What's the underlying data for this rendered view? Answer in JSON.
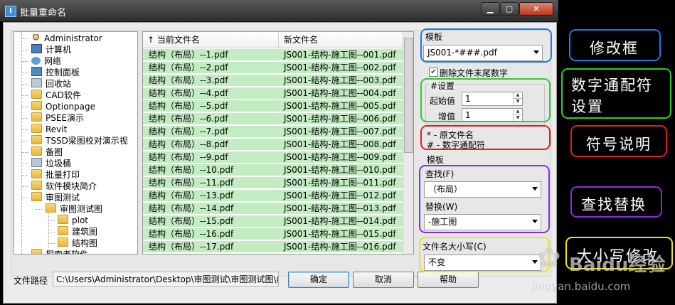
{
  "window": {
    "title": "批量重命名",
    "app_icon": "I"
  },
  "tree": {
    "items": [
      {
        "label": "Administrator",
        "icon": "user-icon"
      },
      {
        "label": "计算机",
        "icon": "computer-icon"
      },
      {
        "label": "网络",
        "icon": "network-icon"
      },
      {
        "label": "控制面板",
        "icon": "control-panel-icon"
      },
      {
        "label": "回收站",
        "icon": "recycle-bin-icon"
      },
      {
        "label": "CAD软件",
        "icon": "folder-icon"
      },
      {
        "label": "Optionpage",
        "icon": "folder-icon"
      },
      {
        "label": "PSEE演示",
        "icon": "folder-icon"
      },
      {
        "label": "Revit",
        "icon": "folder-icon"
      },
      {
        "label": "TSSD梁图校对演示视",
        "icon": "folder-icon"
      },
      {
        "label": "备图",
        "icon": "folder-icon"
      },
      {
        "label": "垃圾桶",
        "icon": "recycle-bin-icon"
      },
      {
        "label": "批量打印",
        "icon": "folder-icon"
      },
      {
        "label": "软件模块简介",
        "icon": "folder-icon"
      },
      {
        "label": "审图测试",
        "icon": "folder-icon"
      },
      {
        "label": "审图测试图",
        "icon": "folder-icon"
      },
      {
        "label": "plot",
        "icon": "folder-icon"
      },
      {
        "label": "建筑图",
        "icon": "folder-icon"
      },
      {
        "label": "结构图",
        "icon": "folder-icon"
      },
      {
        "label": "探索者软件",
        "icon": "folder-icon"
      }
    ]
  },
  "file_list": {
    "headers": {
      "current": "当前文件名",
      "new": "新文件名",
      "sort_arrow": "↑"
    },
    "rows": [
      {
        "current": "结构（布局）--1.pdf",
        "new": "JS001-结构-施工图--001.pdf"
      },
      {
        "current": "结构（布局）--2.pdf",
        "new": "JS001-结构-施工图--002.pdf"
      },
      {
        "current": "结构（布局）--3.pdf",
        "new": "JS001-结构-施工图--003.pdf"
      },
      {
        "current": "结构（布局）--4.pdf",
        "new": "JS001-结构-施工图--004.pdf"
      },
      {
        "current": "结构（布局）--5.pdf",
        "new": "JS001-结构-施工图--005.pdf"
      },
      {
        "current": "结构（布局）--6.pdf",
        "new": "JS001-结构-施工图--006.pdf"
      },
      {
        "current": "结构（布局）--7.pdf",
        "new": "JS001-结构-施工图--007.pdf"
      },
      {
        "current": "结构（布局）--8.pdf",
        "new": "JS001-结构-施工图--008.pdf"
      },
      {
        "current": "结构（布局）--9.pdf",
        "new": "JS001-结构-施工图--009.pdf"
      },
      {
        "current": "结构（布局）--10.pdf",
        "new": "JS001-结构-施工图--010.pdf"
      },
      {
        "current": "结构（布局）--11.pdf",
        "new": "JS001-结构-施工图--011.pdf"
      },
      {
        "current": "结构（布局）--13.pdf",
        "new": "JS001-结构-施工图--012.pdf"
      },
      {
        "current": "结构（布局）--14.pdf",
        "new": "JS001-结构-施工图--013.pdf"
      },
      {
        "current": "结构（布局）--15.pdf",
        "new": "JS001-结构-施工图--014.pdf"
      },
      {
        "current": "结构（布局）--16.pdf",
        "new": "JS001-结构-施工图--015.pdf"
      },
      {
        "current": "结构（布局）--17.pdf",
        "new": "JS001-结构-施工图--016.pdf"
      }
    ]
  },
  "template": {
    "label": "模板",
    "value": "JS001-*###.pdf"
  },
  "delete_suffix": {
    "label": "删除文件末尾数字",
    "checked": true
  },
  "number_settings": {
    "group_label": "#设置",
    "start_label": "起始值",
    "start_value": "1",
    "step_label": "增值",
    "step_value": "1"
  },
  "legend": {
    "line1": "* - 原文件名",
    "line2": "# - 数字通配符"
  },
  "replace_section": {
    "label": "模板",
    "find_label": "查找(F)",
    "find_value": "（布局）",
    "replace_label": "替换(W)",
    "replace_value": "-施工图"
  },
  "case": {
    "label": "文件名大小写(C)",
    "value": "不变"
  },
  "path": {
    "label": "文件路径",
    "value": "C:\\Users\\Administrator\\Desktop\\审图测试\\审图测试图\\结构"
  },
  "buttons": {
    "ok": "确定",
    "cancel": "取消",
    "help": "帮助"
  },
  "annotations": {
    "modify_box": "修改框",
    "wildcard_line1": "数字通配符",
    "wildcard_line2": "设置",
    "symbol_desc": "符号说明",
    "find_replace": "查找替换",
    "case_modify": "大小写修改",
    "colors": {
      "blue": "#1e78e6",
      "green": "#2ecc2e",
      "red": "#e0201e",
      "purple": "#8a2be2",
      "yellow": "#f2e600"
    }
  },
  "watermark": {
    "brand": "Baidu经验",
    "url": "jingyan.baidu.com"
  }
}
